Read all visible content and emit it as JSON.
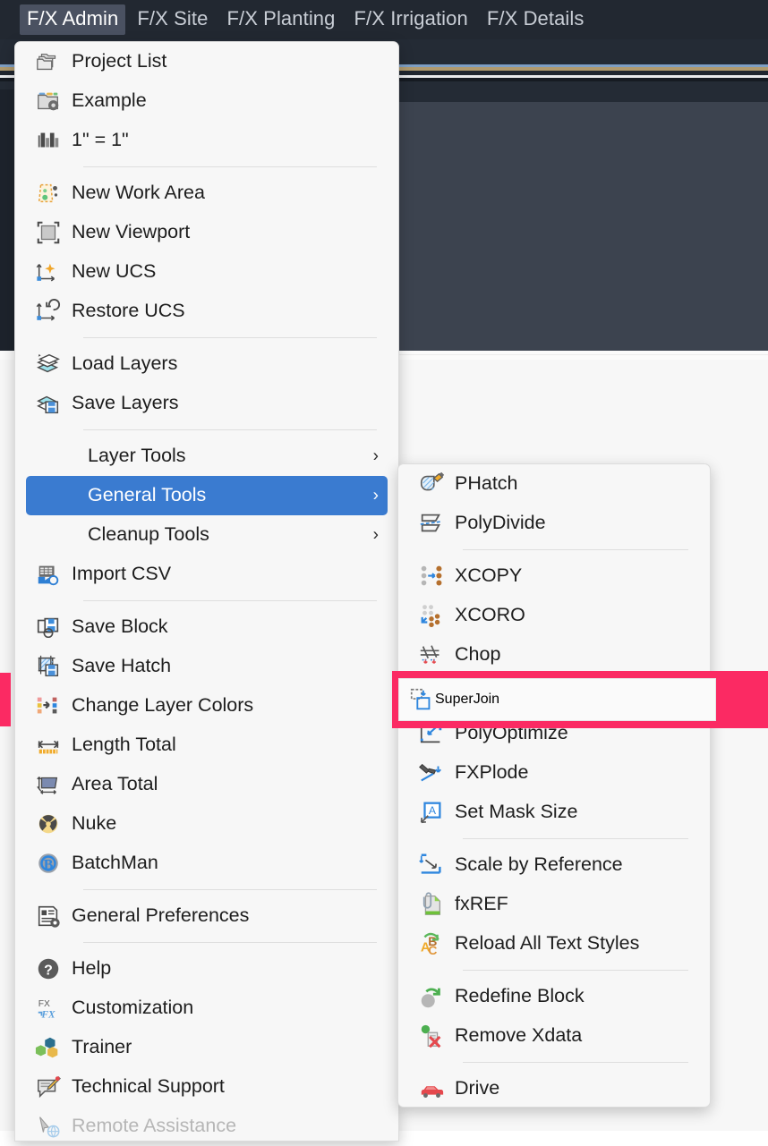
{
  "app": {
    "menubar": [
      {
        "label": "F/X Admin",
        "active": true
      },
      {
        "label": "F/X Site",
        "active": false
      },
      {
        "label": "F/X Planting",
        "active": false
      },
      {
        "label": "F/X Irrigation",
        "active": false
      },
      {
        "label": "F/X Details",
        "active": false
      }
    ]
  },
  "colors": {
    "menubar_bg": "#222831",
    "menu_bg": "#f7f7f7",
    "selected_bg": "#3a7bd0",
    "annotation": "#fb2a63",
    "canvas": "#3c434f"
  },
  "main_menu": {
    "items": [
      {
        "label": "Project List",
        "icon": "folders-icon",
        "type": "item"
      },
      {
        "label": "Example",
        "icon": "folder-settings-icon",
        "type": "item"
      },
      {
        "label": "1\" = 1\"",
        "icon": "scale-bar-icon",
        "type": "item"
      },
      {
        "label": "",
        "icon": "",
        "type": "separator"
      },
      {
        "label": "New Work Area",
        "icon": "work-area-icon",
        "type": "item"
      },
      {
        "label": "New Viewport",
        "icon": "viewport-icon",
        "type": "item"
      },
      {
        "label": "New UCS",
        "icon": "new-ucs-icon",
        "type": "item"
      },
      {
        "label": "Restore UCS",
        "icon": "restore-ucs-icon",
        "type": "item"
      },
      {
        "label": "",
        "icon": "",
        "type": "separator"
      },
      {
        "label": "Load Layers",
        "icon": "load-layers-icon",
        "type": "item"
      },
      {
        "label": "Save Layers",
        "icon": "save-layers-icon",
        "type": "item"
      },
      {
        "label": "",
        "icon": "",
        "type": "separator"
      },
      {
        "label": "Layer Tools",
        "icon": "",
        "type": "submenu"
      },
      {
        "label": "General Tools",
        "icon": "",
        "type": "submenu",
        "selected": true
      },
      {
        "label": "Cleanup Tools",
        "icon": "",
        "type": "submenu"
      },
      {
        "label": "Import CSV",
        "icon": "import-csv-icon",
        "type": "item"
      },
      {
        "label": "",
        "icon": "",
        "type": "separator"
      },
      {
        "label": "Save Block",
        "icon": "save-block-icon",
        "type": "item"
      },
      {
        "label": "Save Hatch",
        "icon": "save-hatch-icon",
        "type": "item"
      },
      {
        "label": "Change Layer Colors",
        "icon": "change-layer-colors-icon",
        "type": "item"
      },
      {
        "label": "Length Total",
        "icon": "length-total-icon",
        "type": "item"
      },
      {
        "label": "Area Total",
        "icon": "area-total-icon",
        "type": "item"
      },
      {
        "label": "Nuke",
        "icon": "nuke-icon",
        "type": "item"
      },
      {
        "label": "BatchMan",
        "icon": "batchman-icon",
        "type": "item"
      },
      {
        "label": "",
        "icon": "",
        "type": "separator"
      },
      {
        "label": "General Preferences",
        "icon": "preferences-icon",
        "type": "item"
      },
      {
        "label": "",
        "icon": "",
        "type": "separator"
      },
      {
        "label": "Help",
        "icon": "help-icon",
        "type": "item"
      },
      {
        "label": "Customization",
        "icon": "customization-icon",
        "type": "item"
      },
      {
        "label": "Trainer",
        "icon": "trainer-icon",
        "type": "item"
      },
      {
        "label": "Technical Support",
        "icon": "tech-support-icon",
        "type": "item"
      },
      {
        "label": "Remote Assistance",
        "icon": "remote-assistance-icon",
        "type": "item",
        "disabled": true
      }
    ]
  },
  "sub_menu": {
    "title": "General Tools",
    "items": [
      {
        "label": "PHatch",
        "icon": "phatch-icon",
        "type": "item"
      },
      {
        "label": "PolyDivide",
        "icon": "polydivide-icon",
        "type": "item"
      },
      {
        "label": "",
        "icon": "",
        "type": "separator"
      },
      {
        "label": "XCOPY",
        "icon": "xcopy-icon",
        "type": "item"
      },
      {
        "label": "XCORO",
        "icon": "xcoro-icon",
        "type": "item"
      },
      {
        "label": "Chop",
        "icon": "chop-icon",
        "type": "item"
      },
      {
        "label": "SuperJoin",
        "icon": "superjoin-icon",
        "type": "item",
        "highlighted": true
      },
      {
        "label": "PolyOptimize",
        "icon": "polyoptimize-icon",
        "type": "item"
      },
      {
        "label": "FXPlode",
        "icon": "fxplode-icon",
        "type": "item"
      },
      {
        "label": "Set Mask Size",
        "icon": "set-mask-size-icon",
        "type": "item"
      },
      {
        "label": "",
        "icon": "",
        "type": "separator"
      },
      {
        "label": "Scale by Reference",
        "icon": "scale-by-reference-icon",
        "type": "item"
      },
      {
        "label": "fxREF",
        "icon": "fxref-icon",
        "type": "item"
      },
      {
        "label": "Reload All Text Styles",
        "icon": "reload-text-styles-icon",
        "type": "item"
      },
      {
        "label": "",
        "icon": "",
        "type": "separator"
      },
      {
        "label": "Redefine Block",
        "icon": "redefine-block-icon",
        "type": "item"
      },
      {
        "label": "Remove Xdata",
        "icon": "remove-xdata-icon",
        "type": "item"
      },
      {
        "label": "",
        "icon": "",
        "type": "separator"
      },
      {
        "label": "Drive",
        "icon": "drive-icon",
        "type": "item"
      }
    ]
  },
  "annotation": {
    "target_label": "SuperJoin",
    "target_icon": "superjoin-icon"
  }
}
